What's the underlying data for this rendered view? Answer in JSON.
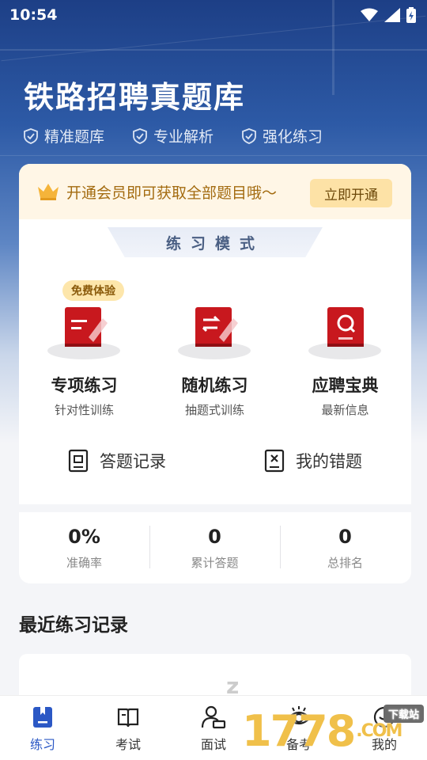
{
  "status_bar": {
    "time": "10:54"
  },
  "header": {
    "title": "铁路招聘真题库",
    "features": [
      "精准题库",
      "专业解析",
      "强化练习"
    ]
  },
  "vip": {
    "text": "开通会员即可获取全部题目哦～",
    "button": "立即开通"
  },
  "mode_section": {
    "title": "练习模式",
    "badge": "免费体验",
    "modes": [
      {
        "name": "专项练习",
        "sub": "针对性训练"
      },
      {
        "name": "随机练习",
        "sub": "抽题式训练"
      },
      {
        "name": "应聘宝典",
        "sub": "最新信息"
      }
    ]
  },
  "records": {
    "history": "答题记录",
    "mistakes": "我的错题"
  },
  "stats": [
    {
      "value": "0%",
      "label": "准确率"
    },
    {
      "value": "0",
      "label": "累计答题"
    },
    {
      "value": "0",
      "label": "总排名"
    }
  ],
  "recent": {
    "title": "最近练习记录",
    "placeholder": "z"
  },
  "tabbar": [
    {
      "label": "练习",
      "active": true
    },
    {
      "label": "考试"
    },
    {
      "label": "面试"
    },
    {
      "label": "备考"
    },
    {
      "label": "我的"
    }
  ],
  "watermark": {
    "text": "1778",
    "tag": "下载站",
    "suffix": ".COM"
  },
  "colors": {
    "primary": "#2b58c5",
    "hero": "#1d3f86",
    "vip_text": "#a36b10",
    "book_red": "#c8181e"
  }
}
